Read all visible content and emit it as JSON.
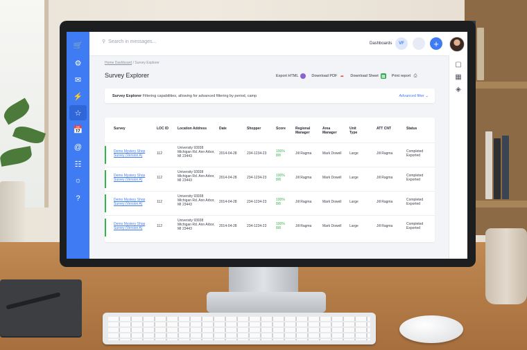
{
  "colors": {
    "accent": "#3f7cf4",
    "success": "#37b24d",
    "sidebar": "#3f7cf4"
  },
  "sidebar": {
    "items": [
      {
        "icon": "cart-icon"
      },
      {
        "icon": "gear-icon"
      },
      {
        "icon": "mail-icon"
      },
      {
        "icon": "bolt-icon"
      },
      {
        "icon": "star-check-icon",
        "active": true
      },
      {
        "icon": "calendar-icon"
      },
      {
        "icon": "at-icon"
      },
      {
        "icon": "contact-icon"
      },
      {
        "icon": "bulb-icon"
      },
      {
        "icon": "help-icon"
      }
    ]
  },
  "topbar": {
    "search_placeholder": "Search in messages...",
    "dashboards_label": "Dashboards",
    "user_initials": "VF",
    "add_symbol": "+"
  },
  "breadcrumb": {
    "home": "Home Dashboard",
    "separator": "/",
    "current": "Survey Explorer"
  },
  "page_title": "Survey Explorer",
  "actions": {
    "export_html": "Export HTML",
    "download_pdf": "Download PDF",
    "download_sheet": "Download Sheet",
    "print_report": "Print report"
  },
  "filter": {
    "title": "Survey Explorer",
    "description": "Filtering capabilities, allowing for advanced filtering by period, camp",
    "advanced_label": "Advanced filter"
  },
  "table": {
    "columns": [
      "Survey",
      "LOC ID",
      "Location Address",
      "Date",
      "Shopper",
      "Score",
      "Regional Manager",
      "Area Manager",
      "Unit Type",
      "ATT CNT",
      "Status"
    ],
    "rows": [
      {
        "survey": "Demo Mystery Shop Survey (Version A)",
        "loc_id": "112",
        "address": "University 93938 Michigan Rd. Ann Arbor, MI 23443",
        "date": "2014-04-28",
        "shopper": "234-1234-23",
        "score": "100% 8/8",
        "regional_manager": "Jill Ragma",
        "area_manager": "Mark Dowell",
        "unit_type": "Large",
        "att_cnt": "Jill Ragma",
        "status": "Completed Exported"
      },
      {
        "survey": "Demo Mystery Shop Survey (Version A)",
        "loc_id": "112",
        "address": "University 93938 Michigan Rd. Ann Arbor, MI 23443",
        "date": "2014-04-28",
        "shopper": "234-1234-23",
        "score": "100% 8/8",
        "regional_manager": "Jill Ragma",
        "area_manager": "Mark Dowell",
        "unit_type": "Large",
        "att_cnt": "Jill Ragma",
        "status": "Completed Exported"
      },
      {
        "survey": "Demo Mystery Shop Survey (Version A)",
        "loc_id": "112",
        "address": "University 93938 Michigan Rd. Ann Arbor, MI 23443",
        "date": "2014-04-28",
        "shopper": "234-1234-23",
        "score": "100% 8/8",
        "regional_manager": "Jill Ragma",
        "area_manager": "Mark Dowell",
        "unit_type": "Large",
        "att_cnt": "Jill Ragma",
        "status": "Completed Exported"
      },
      {
        "survey": "Demo Mystery Shop Survey (Version A)",
        "loc_id": "112",
        "address": "University 93938 Michigan Rd. Ann Arbor, MI 23443",
        "date": "2014-04-28",
        "shopper": "234-1234-23",
        "score": "100% 8/8",
        "regional_manager": "Jill Ragma",
        "area_manager": "Mark Dowell",
        "unit_type": "Large",
        "att_cnt": "Jill Ragma",
        "status": "Completed Exported"
      }
    ]
  },
  "right_rail": {
    "icons": [
      "inbox-icon",
      "calendar-grid-icon",
      "layers-icon"
    ]
  }
}
